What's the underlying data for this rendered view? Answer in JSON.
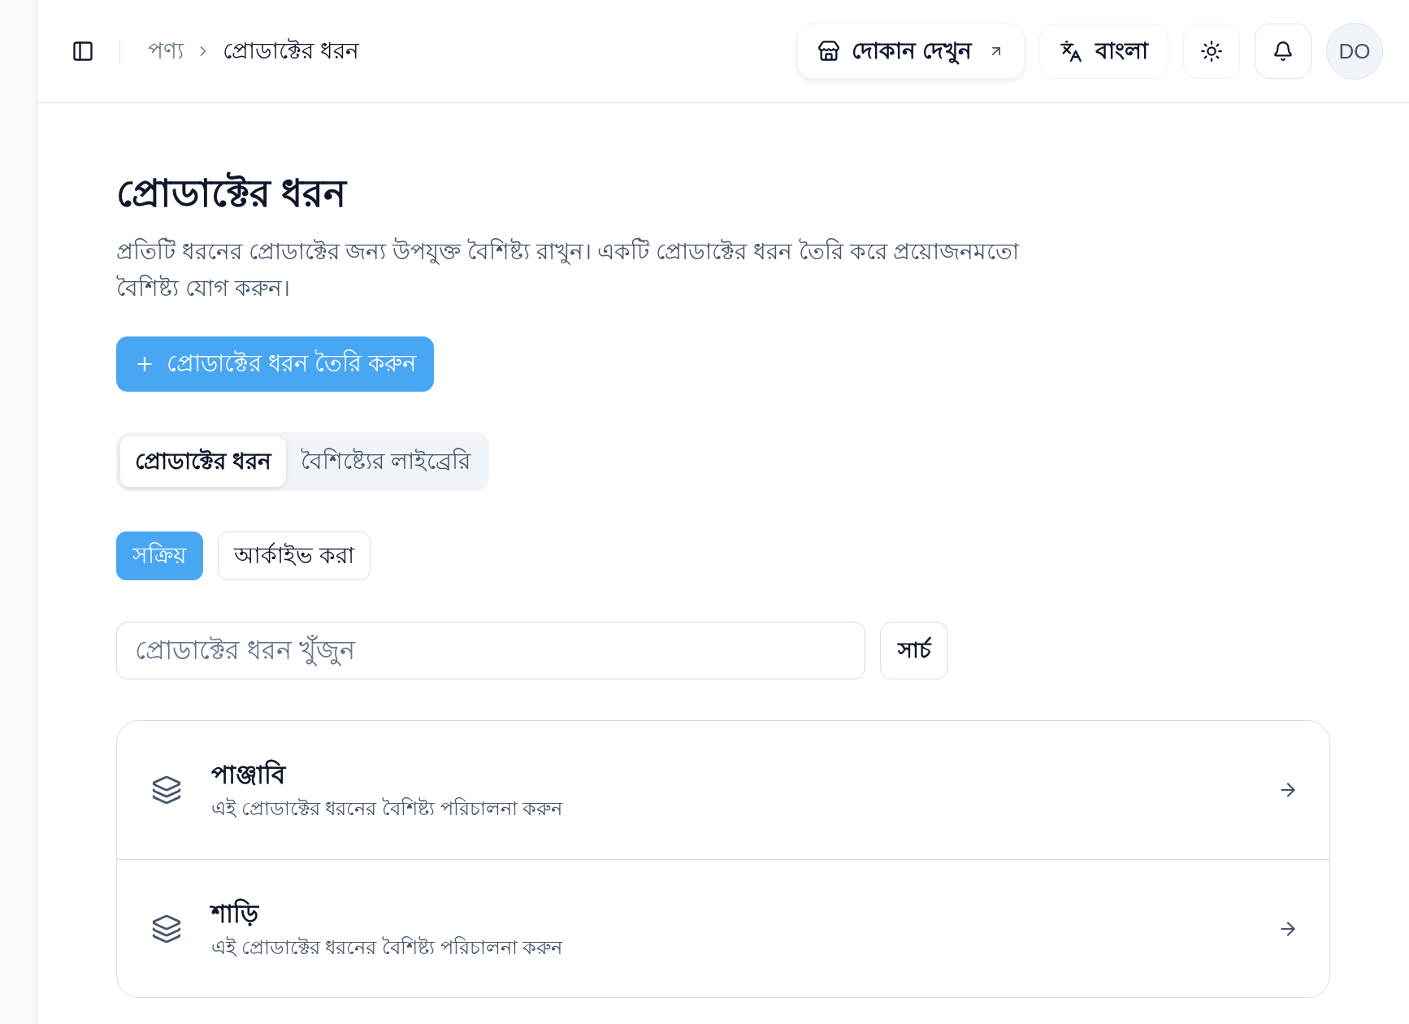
{
  "header": {
    "breadcrumb": [
      {
        "label": "পণ্য",
        "current": false
      },
      {
        "label": "প্রোডাক্টের ধরন",
        "current": true
      }
    ],
    "store_button": {
      "label": "দোকান দেখুন"
    },
    "language_button": {
      "label": "বাংলা"
    },
    "avatar": {
      "initials": "DO"
    }
  },
  "page": {
    "title": "প্রোডাক্টের ধরন",
    "description": "প্রতিটি ধরনের প্রোডাক্টের জন্য উপযুক্ত বৈশিষ্ট্য রাখুন। একটি প্রোডাক্টের ধরন তৈরি করে প্রয়োজনমতো বৈশিষ্ট্য যোগ করুন।",
    "create_button": "প্রোডাক্টের ধরন তৈরি করুন"
  },
  "tabs": [
    {
      "label": "প্রোডাক্টের ধরন",
      "selected": true
    },
    {
      "label": "বৈশিষ্ট্যের লাইব্রেরি",
      "selected": false
    }
  ],
  "filters": [
    {
      "label": "সক্রিয়",
      "selected": true
    },
    {
      "label": "আর্কাইভ করা",
      "selected": false
    }
  ],
  "search": {
    "placeholder": "প্রোডাক্টের ধরন খুঁজুন",
    "button": "সার্চ"
  },
  "product_types": [
    {
      "name": "পাঞ্জাবি",
      "description": "এই প্রোডাক্টের ধরনের বৈশিষ্ট্য পরিচালনা করুন"
    },
    {
      "name": "শাড়ি",
      "description": "এই প্রোডাক্টের ধরনের বৈশিষ্ট্য পরিচালনা করুন"
    }
  ]
}
